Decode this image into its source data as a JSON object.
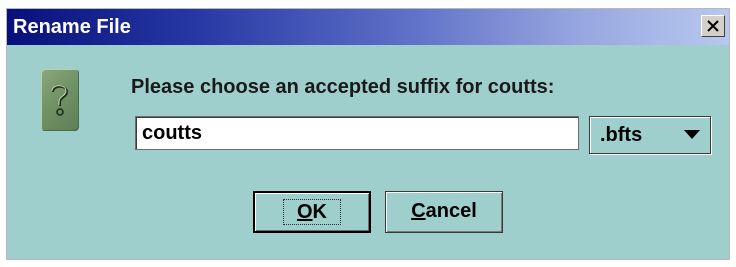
{
  "dialog": {
    "title": "Rename File",
    "close_symbol": "X",
    "icon": "question-icon",
    "prompt": "Please choose an accepted suffix for coutts:",
    "name_value": "coutts",
    "suffix_selected": ".bfts",
    "buttons": {
      "ok_mnemonic": "O",
      "ok_rest": "K",
      "cancel_mnemonic": "C",
      "cancel_rest": "ancel"
    }
  },
  "colors": {
    "dialog_background": "#9fcfcd",
    "titlebar_start": "#07107a",
    "titlebar_end": "#b8c8ef"
  }
}
